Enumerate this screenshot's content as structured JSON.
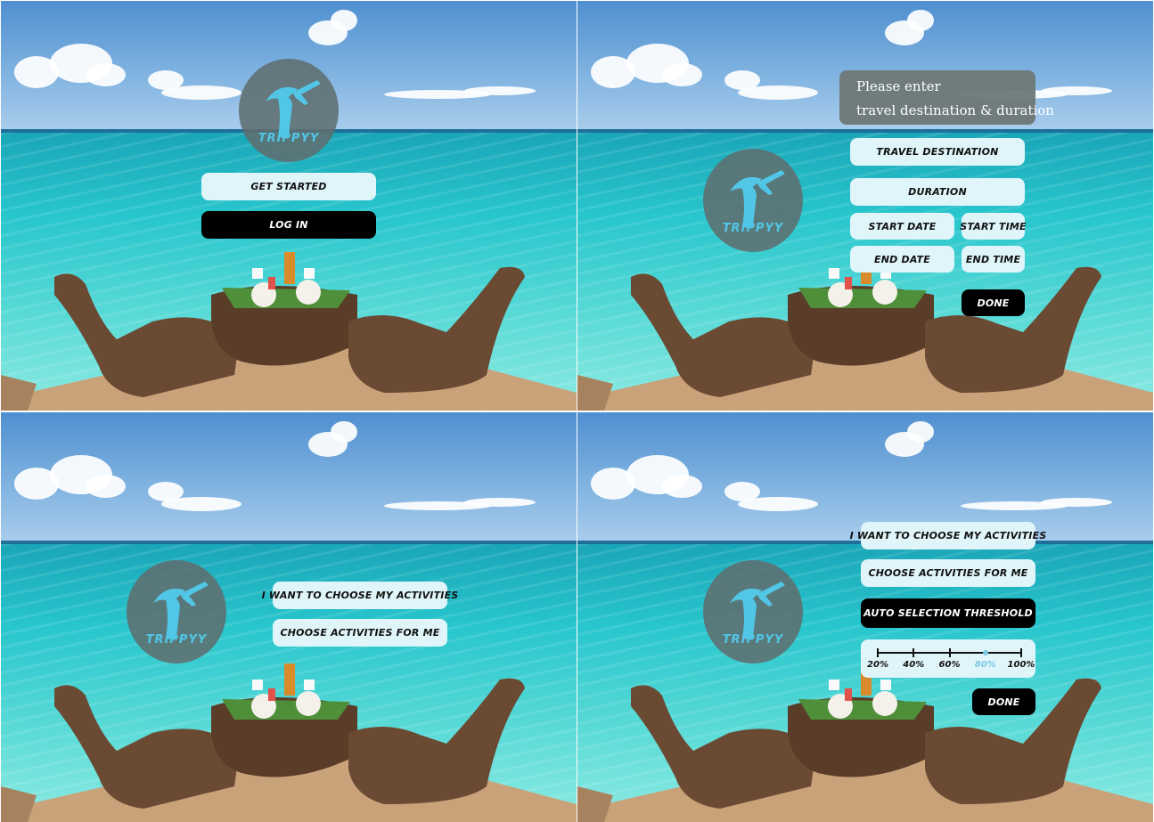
{
  "brand": {
    "name": "TRIPPYY"
  },
  "screen1": {
    "get_started": "GET STARTED",
    "log_in": "LOG IN"
  },
  "screen2": {
    "prompt_line1": "Please enter",
    "prompt_line2": "travel destination & duration",
    "travel_destination": "TRAVEL DESTINATION",
    "duration": "DURATION",
    "start_date": "START DATE",
    "start_time": "START TIME",
    "end_date": "END DATE",
    "end_time": "END TIME",
    "done": "DONE"
  },
  "screen3": {
    "choose_my": "I WANT TO CHOOSE MY ACTIVITIES",
    "choose_for_me": "CHOOSE ACTIVITIES FOR ME"
  },
  "screen4": {
    "choose_my": "I WANT TO CHOOSE MY ACTIVITIES",
    "choose_for_me": "CHOOSE ACTIVITIES FOR ME",
    "threshold": "AUTO SELECTION THRESHOLD",
    "slider": {
      "ticks": [
        "20%",
        "40%",
        "60%",
        "80%",
        "100%"
      ],
      "selected": "80%"
    },
    "done": "DONE"
  },
  "colors": {
    "button_light": "#dff5fa",
    "button_dark": "#000000",
    "accent": "#52c6e6",
    "logo_bg": "#5f6e70"
  },
  "icons": {
    "logo": "airplane-t-logo"
  }
}
